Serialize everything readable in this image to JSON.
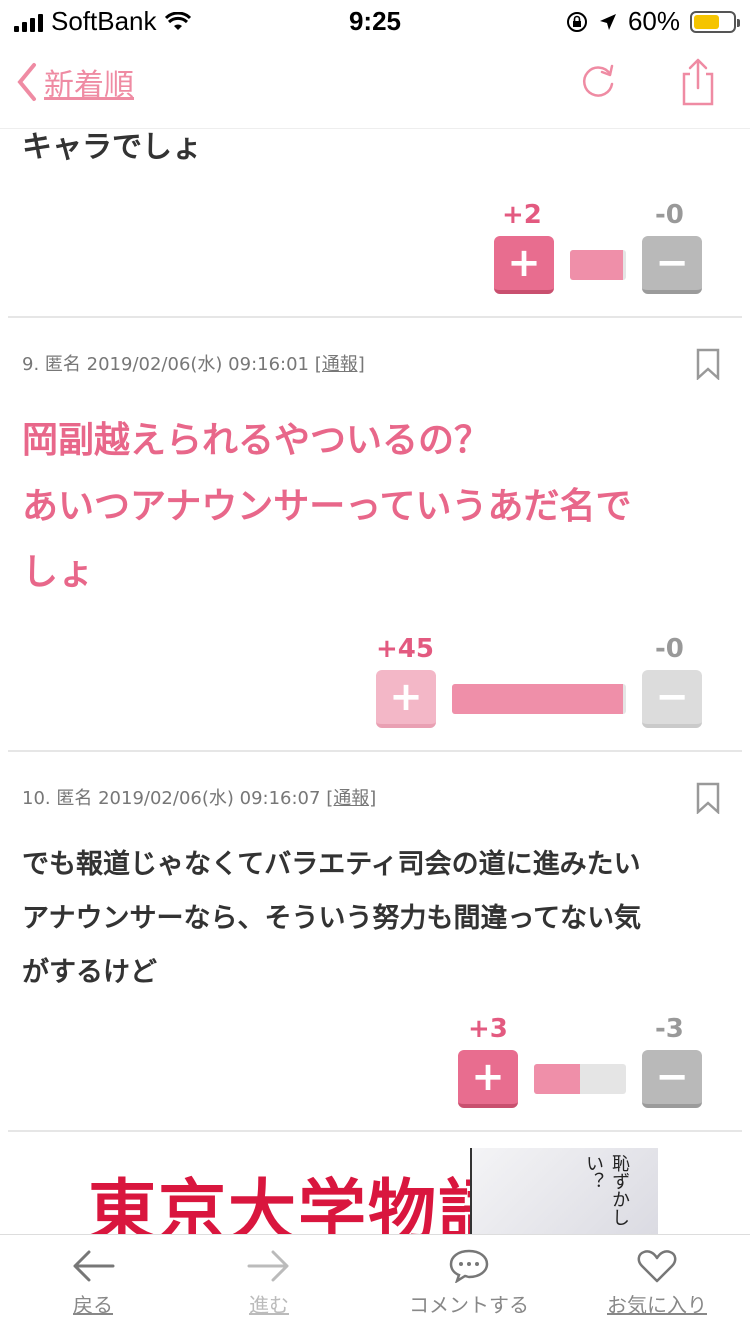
{
  "status_bar": {
    "carrier": "SoftBank",
    "time": "9:25",
    "battery": "60%"
  },
  "nav": {
    "back_label": "新着順"
  },
  "comments": [
    {
      "partial_text": "キャラでしょ",
      "plus": "+2",
      "minus": "-0",
      "plus_ratio": 0.95
    },
    {
      "number": "9.",
      "author": "匿名",
      "datetime": "2019/02/06(水) 09:16:01",
      "report": "[通報]",
      "lines": [
        "岡副越えられるやついるの？",
        "あいつアナウンサーっていうあだ名で",
        "しょ"
      ],
      "plus": "+45",
      "minus": "-0",
      "plus_ratio": 0.98
    },
    {
      "number": "10.",
      "author": "匿名",
      "datetime": "2019/02/06(水) 09:16:07",
      "report": "[通報]",
      "lines": [
        "でも報道じゃなくてバラエティ司会の道に進みたい",
        "アナウンサーなら、そういう努力も間違ってない気",
        "がするけど"
      ],
      "plus": "+3",
      "minus": "-3",
      "plus_ratio": 0.5
    }
  ],
  "ad": {
    "title": "東京大学物語",
    "art_text": "恥ずかしい？"
  },
  "toolbar": {
    "back": "戻る",
    "forward": "進む",
    "comment": "コメントする",
    "favorite": "お気に入り"
  },
  "colors": {
    "accent": "#ef8ba3",
    "plus": "#e86d8f",
    "minus": "#b9b9b9",
    "ad_red": "#d9163e"
  }
}
